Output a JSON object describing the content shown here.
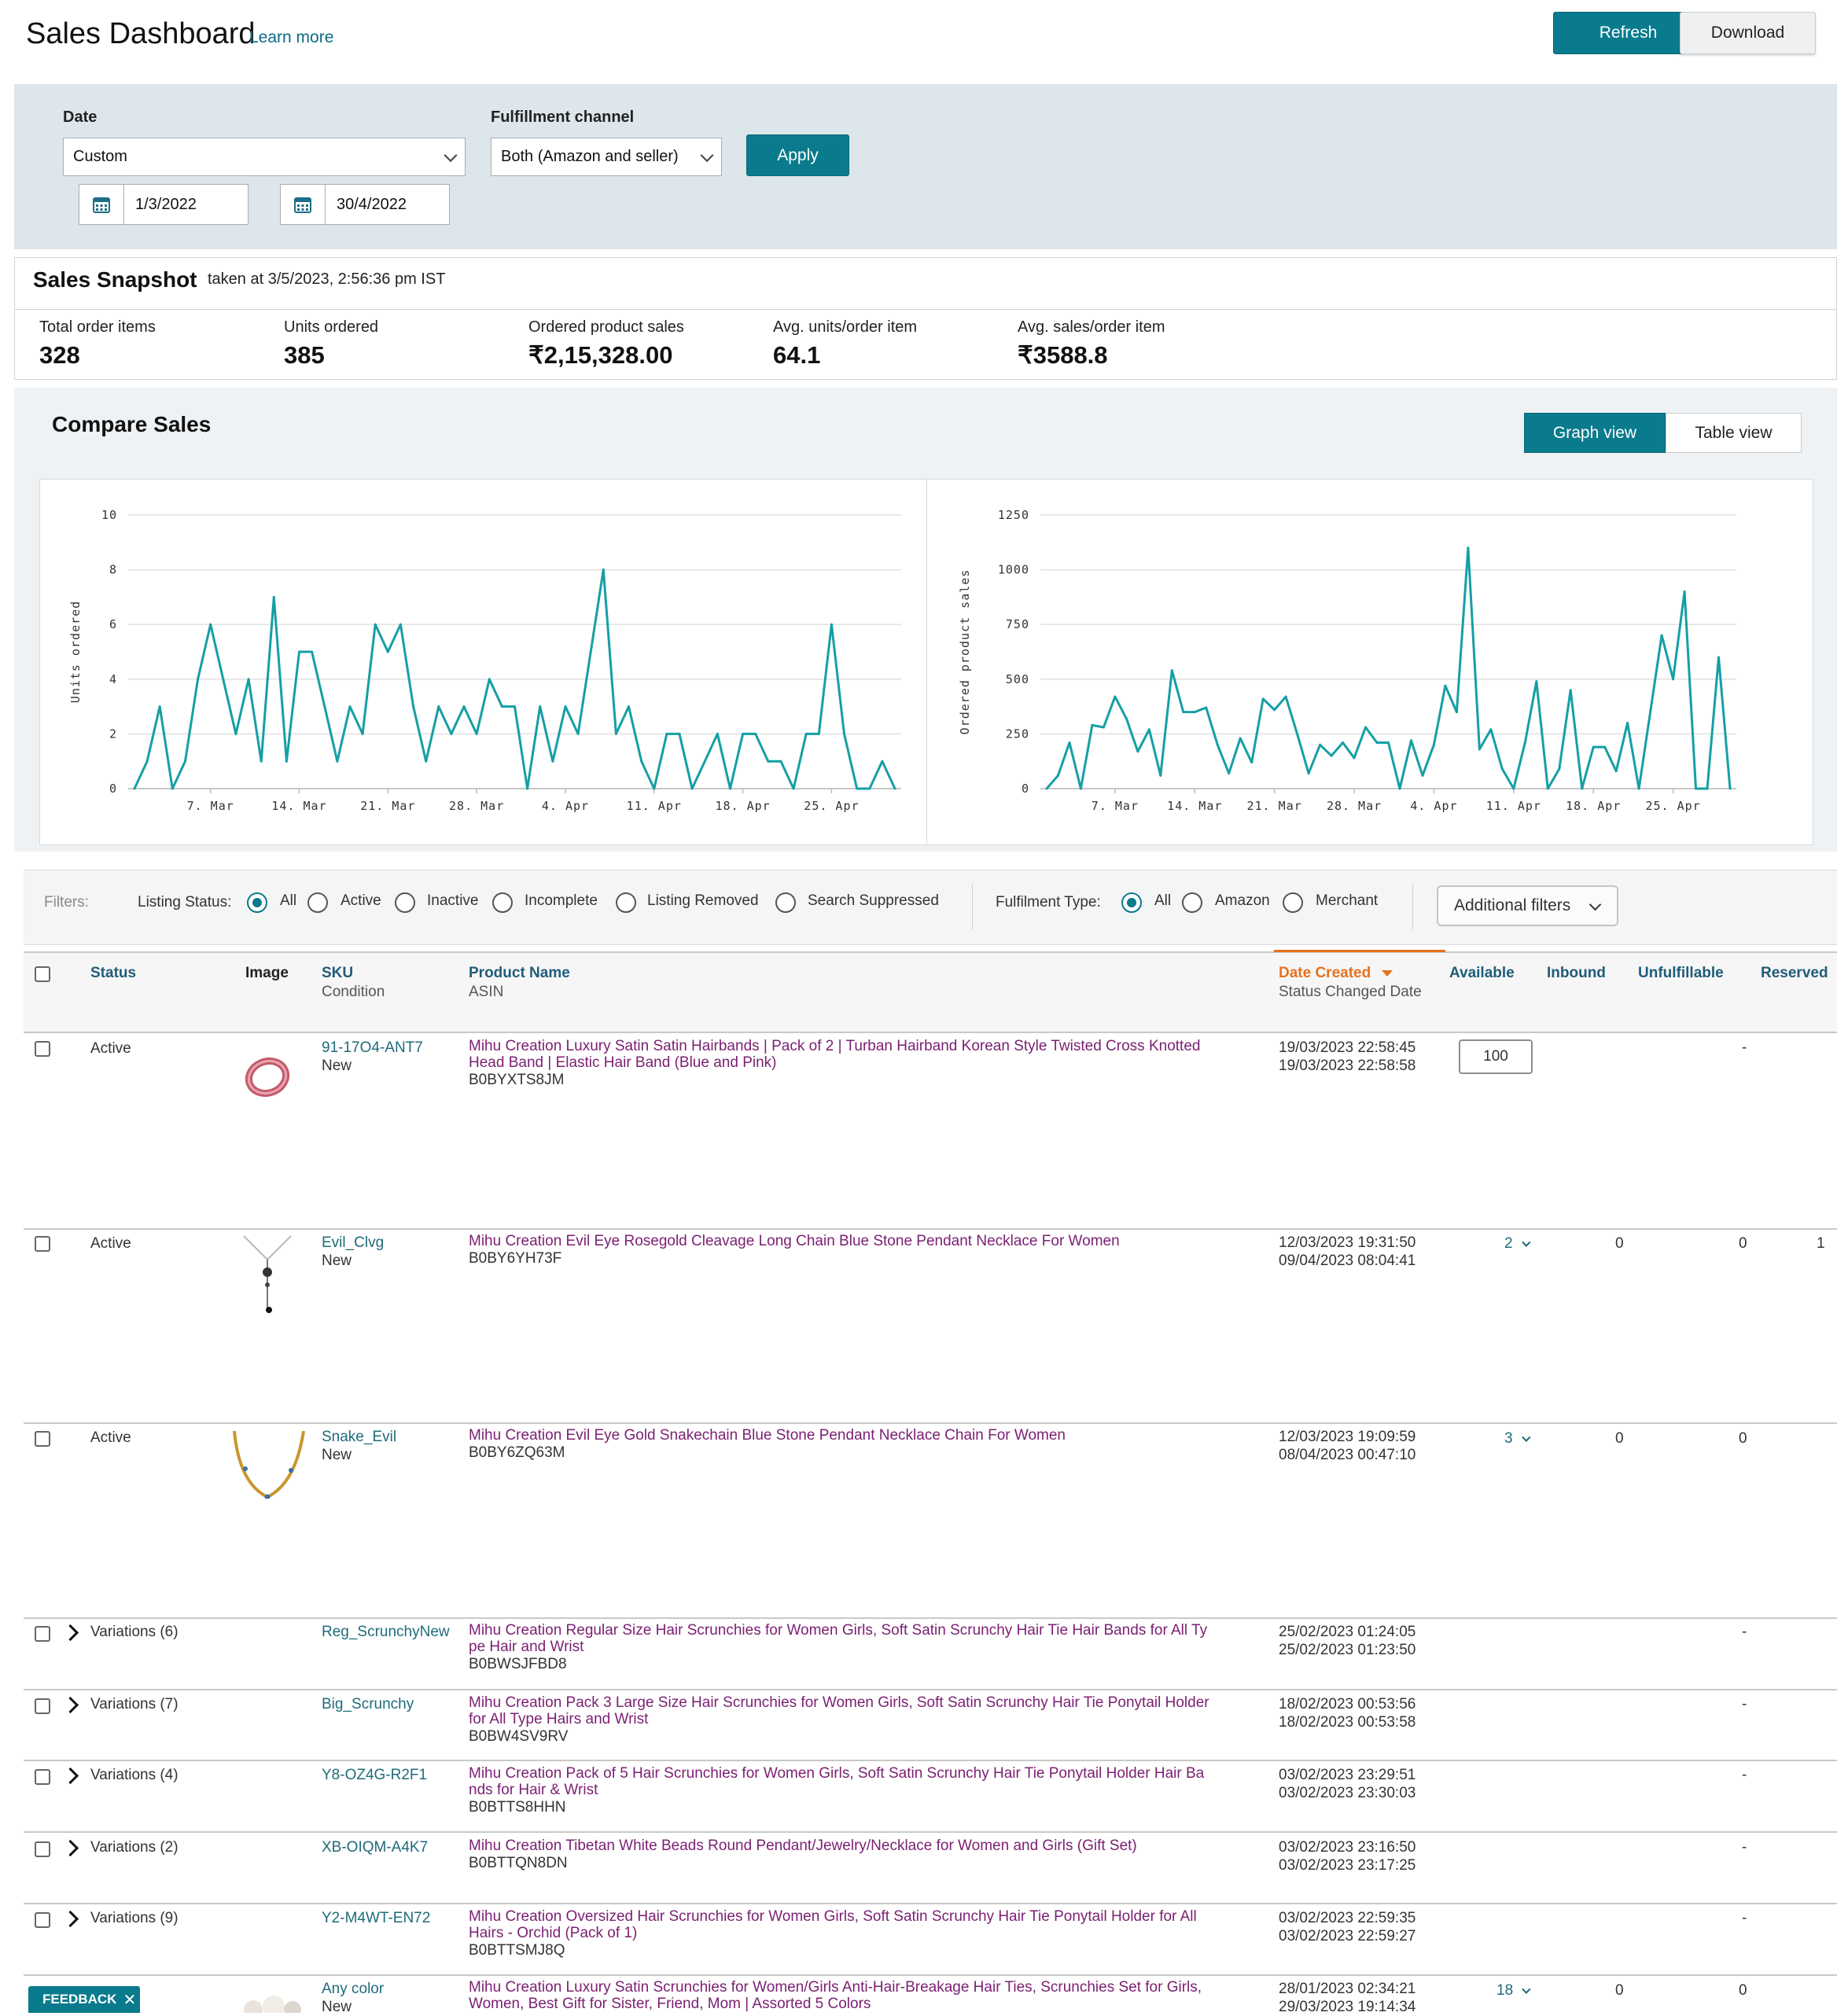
{
  "header": {
    "title": "Sales Dashboard",
    "learn_more": "Learn more",
    "refresh": "Refresh",
    "download": "Download"
  },
  "filters_top": {
    "date_label": "Date",
    "date_value": "Custom",
    "channel_label": "Fulfillment channel",
    "channel_value": "Both (Amazon and seller)",
    "apply": "Apply",
    "start_date": "1/3/2022",
    "end_date": "30/4/2022"
  },
  "snapshot": {
    "title": "Sales Snapshot",
    "taken_at": "taken at 3/5/2023, 2:56:36 pm IST",
    "metrics": [
      {
        "label": "Total order items",
        "value": "328"
      },
      {
        "label": "Units ordered",
        "value": "385"
      },
      {
        "label": "Ordered product sales",
        "value": "₹2,15,328.00"
      },
      {
        "label": "Avg. units/order item",
        "value": "64.1"
      },
      {
        "label": "Avg. sales/order item",
        "value": "₹3588.8"
      }
    ]
  },
  "compare": {
    "title": "Compare Sales",
    "graph_view": "Graph view",
    "table_view": "Table view"
  },
  "chart_data": [
    {
      "type": "line",
      "ylabel": "Units ordered",
      "ylim": [
        0,
        10
      ],
      "yticks": [
        "0",
        "2",
        "4",
        "6",
        "8",
        "10"
      ],
      "xtick_labels": [
        "7. Mar",
        "14. Mar",
        "21. Mar",
        "28. Mar",
        "4. Apr",
        "11. Apr",
        "18. Apr",
        "25. Apr"
      ],
      "x": [
        "1 Mar",
        "2 Mar",
        "3 Mar",
        "4 Mar",
        "5 Mar",
        "6 Mar",
        "7 Mar",
        "8 Mar",
        "9 Mar",
        "10 Mar",
        "11 Mar",
        "12 Mar",
        "13 Mar",
        "14 Mar",
        "15 Mar",
        "16 Mar",
        "17 Mar",
        "18 Mar",
        "19 Mar",
        "20 Mar",
        "21 Mar",
        "22 Mar",
        "23 Mar",
        "24 Mar",
        "25 Mar",
        "26 Mar",
        "27 Mar",
        "28 Mar",
        "29 Mar",
        "30 Mar",
        "31 Mar",
        "1 Apr",
        "2 Apr",
        "3 Apr",
        "4 Apr",
        "5 Apr",
        "6 Apr",
        "7 Apr",
        "8 Apr",
        "9 Apr",
        "10 Apr",
        "11 Apr",
        "12 Apr",
        "13 Apr",
        "14 Apr",
        "15 Apr",
        "16 Apr",
        "17 Apr",
        "18 Apr",
        "19 Apr",
        "20 Apr",
        "21 Apr",
        "22 Apr",
        "23 Apr",
        "24 Apr",
        "25 Apr",
        "26 Apr",
        "27 Apr",
        "28 Apr",
        "29 Apr",
        "30 Apr"
      ],
      "values": [
        0,
        1,
        3,
        0,
        1,
        4,
        6,
        4,
        2,
        4,
        1,
        7,
        1,
        5,
        5,
        3,
        1,
        3,
        2,
        6,
        5,
        6,
        3,
        1,
        3,
        2,
        3,
        2,
        4,
        3,
        3,
        0,
        3,
        1,
        3,
        2,
        5,
        8,
        2,
        3,
        1,
        0,
        2,
        2,
        0,
        1,
        2,
        0,
        2,
        2,
        1,
        1,
        0,
        2,
        2,
        6,
        2,
        0,
        0,
        1,
        0
      ],
      "grid": true,
      "color": "#159fa5"
    },
    {
      "type": "line",
      "ylabel": "Ordered product sales",
      "ylim": [
        0,
        1250
      ],
      "yticks": [
        "0",
        "250",
        "500",
        "750",
        "1000",
        "1250"
      ],
      "xtick_labels": [
        "7. Mar",
        "14. Mar",
        "21. Mar",
        "28. Mar",
        "4. Apr",
        "11. Apr",
        "18. Apr",
        "25. Apr"
      ],
      "x": [
        "1 Mar",
        "2 Mar",
        "3 Mar",
        "4 Mar",
        "5 Mar",
        "6 Mar",
        "7 Mar",
        "8 Mar",
        "9 Mar",
        "10 Mar",
        "11 Mar",
        "12 Mar",
        "13 Mar",
        "14 Mar",
        "15 Mar",
        "16 Mar",
        "17 Mar",
        "18 Mar",
        "19 Mar",
        "20 Mar",
        "21 Mar",
        "22 Mar",
        "23 Mar",
        "24 Mar",
        "25 Mar",
        "26 Mar",
        "27 Mar",
        "28 Mar",
        "29 Mar",
        "30 Mar",
        "31 Mar",
        "1 Apr",
        "2 Apr",
        "3 Apr",
        "4 Apr",
        "5 Apr",
        "6 Apr",
        "7 Apr",
        "8 Apr",
        "9 Apr",
        "10 Apr",
        "11 Apr",
        "12 Apr",
        "13 Apr",
        "14 Apr",
        "15 Apr",
        "16 Apr",
        "17 Apr",
        "18 Apr",
        "19 Apr",
        "20 Apr",
        "21 Apr",
        "22 Apr",
        "23 Apr",
        "24 Apr",
        "25 Apr",
        "26 Apr",
        "27 Apr",
        "28 Apr",
        "29 Apr",
        "30 Apr"
      ],
      "values": [
        0,
        60,
        210,
        0,
        290,
        280,
        420,
        320,
        170,
        270,
        60,
        540,
        350,
        350,
        370,
        200,
        70,
        230,
        120,
        410,
        360,
        420,
        250,
        70,
        200,
        150,
        210,
        140,
        280,
        210,
        210,
        0,
        220,
        60,
        200,
        470,
        350,
        1100,
        180,
        270,
        90,
        0,
        210,
        490,
        0,
        90,
        450,
        0,
        190,
        190,
        80,
        300,
        0,
        350,
        700,
        500,
        900,
        0,
        0,
        600,
        0
      ],
      "grid": true,
      "color": "#159fa5"
    }
  ],
  "filter_bar": {
    "filters": "Filters:",
    "listing_status": "Listing Status:",
    "status_options": [
      "All",
      "Active",
      "Inactive",
      "Incomplete",
      "Listing Removed",
      "Search Suppressed"
    ],
    "fulfilment_type": "Fulfilment Type:",
    "type_options": [
      "All",
      "Amazon",
      "Merchant"
    ],
    "additional": "Additional filters"
  },
  "table": {
    "headers": {
      "status": "Status",
      "image": "Image",
      "sku": "SKU",
      "condition": "Condition",
      "product_name": "Product Name",
      "asin": "ASIN",
      "date_created": "Date Created",
      "status_changed": "Status Changed Date",
      "available": "Available",
      "inbound": "Inbound",
      "unfulfillable": "Unfulfillable",
      "reserved": "Reserved"
    },
    "rows": [
      {
        "status": "Active",
        "sku": "91-17O4-ANT7",
        "condition": "New",
        "name1": "Mihu Creation Luxury Satin Satin Hairbands | Pack of 2 | Turban Hairband Korean Style Twisted Cross Knotted",
        "name2": "Head Band | Elastic Hair Band (Blue and Pink)",
        "asin": "B0BYXTS8JM",
        "created": "19/03/2023 22:58:45",
        "changed": "19/03/2023 22:58:58",
        "available": "100",
        "inbound": "",
        "unfulfillable": "-",
        "reserved": ""
      },
      {
        "status": "Active",
        "sku": "Evil_Clvg",
        "condition": "New",
        "name1": "Mihu Creation Evil Eye Rosegold Cleavage Long Chain Blue Stone Pendant Necklace For Women",
        "name2": "",
        "asin": "B0BY6YH73F",
        "created": "12/03/2023 19:31:50",
        "changed": "09/04/2023 08:04:41",
        "available": "2",
        "inbound": "0",
        "unfulfillable": "0",
        "reserved": "1"
      },
      {
        "status": "Active",
        "sku": "Snake_Evil",
        "condition": "New",
        "name1": "Mihu Creation Evil Eye Gold Snakechain Blue Stone Pendant Necklace Chain For Women",
        "name2": "",
        "asin": "B0BY6ZQ63M",
        "created": "12/03/2023 19:09:59",
        "changed": "08/04/2023 00:47:10",
        "available": "3",
        "inbound": "0",
        "unfulfillable": "0",
        "reserved": ""
      },
      {
        "status": "Variations (6)",
        "sku": "Reg_ScrunchyNew",
        "condition": "",
        "name1": "Mihu Creation Regular Size Hair Scrunchies for Women Girls, Soft Satin Scrunchy Hair Tie Hair Bands for All Ty",
        "name2": "pe Hair and Wrist",
        "asin": "B0BWSJFBD8",
        "created": "25/02/2023 01:24:05",
        "changed": "25/02/2023 01:23:50",
        "available": "",
        "inbound": "",
        "unfulfillable": "-",
        "reserved": ""
      },
      {
        "status": "Variations (7)",
        "sku": "Big_Scrunchy",
        "condition": "",
        "name1": "Mihu Creation Pack 3 Large Size Hair Scrunchies for Women Girls, Soft Satin Scrunchy Hair Tie Ponytail Holder",
        "name2": "for All Type Hairs and Wrist",
        "asin": "B0BW4SV9RV",
        "created": "18/02/2023 00:53:56",
        "changed": "18/02/2023 00:53:58",
        "available": "",
        "inbound": "",
        "unfulfillable": "-",
        "reserved": ""
      },
      {
        "status": "Variations (4)",
        "sku": "Y8-OZ4G-R2F1",
        "condition": "",
        "name1": "Mihu Creation Pack of 5 Hair Scrunchies for Women Girls, Soft Satin Scrunchy Hair Tie Ponytail Holder Hair Ba",
        "name2": "nds for Hair & Wrist",
        "asin": "B0BTTS8HHN",
        "created": "03/02/2023 23:29:51",
        "changed": "03/02/2023 23:30:03",
        "available": "",
        "inbound": "",
        "unfulfillable": "-",
        "reserved": ""
      },
      {
        "status": "Variations (2)",
        "sku": "XB-OIQM-A4K7",
        "condition": "",
        "name1": "Mihu Creation Tibetan White Beads Round Pendant/Jewelry/Necklace for Women and Girls (Gift Set)",
        "name2": "",
        "asin": "B0BTTQN8DN",
        "created": "03/02/2023 23:16:50",
        "changed": "03/02/2023 23:17:25",
        "available": "",
        "inbound": "",
        "unfulfillable": "-",
        "reserved": ""
      },
      {
        "status": "Variations (9)",
        "sku": "Y2-M4WT-EN72",
        "condition": "",
        "name1": "Mihu Creation Oversized Hair Scrunchies for Women Girls, Soft Satin Scrunchy Hair Tie Ponytail Holder for All",
        "name2": "Hairs - Orchid (Pack of 1)",
        "asin": "B0BTTSMJ8Q",
        "created": "03/02/2023 22:59:35",
        "changed": "03/02/2023 22:59:27",
        "available": "",
        "inbound": "",
        "unfulfillable": "-",
        "reserved": ""
      },
      {
        "status": "",
        "sku": "Any color",
        "condition": "New",
        "name1": "Mihu Creation Luxury Satin Scrunchies for Women/Girls Anti-Hair-Breakage Hair Ties, Scrunchies Set for Girls,",
        "name2": "Women, Best Gift for Sister, Friend, Mom | Assorted 5 Colors",
        "asin": "",
        "created": "28/01/2023 02:34:21",
        "changed": "29/03/2023 19:14:34",
        "available": "18",
        "inbound": "0",
        "unfulfillable": "0",
        "reserved": ""
      }
    ]
  },
  "feedback": "FEEDBACK",
  "colors": {
    "accent": "#0a7b8c",
    "chart_line": "#159fa5",
    "product_link": "#7b1f72",
    "sort_header": "#e8711d"
  }
}
